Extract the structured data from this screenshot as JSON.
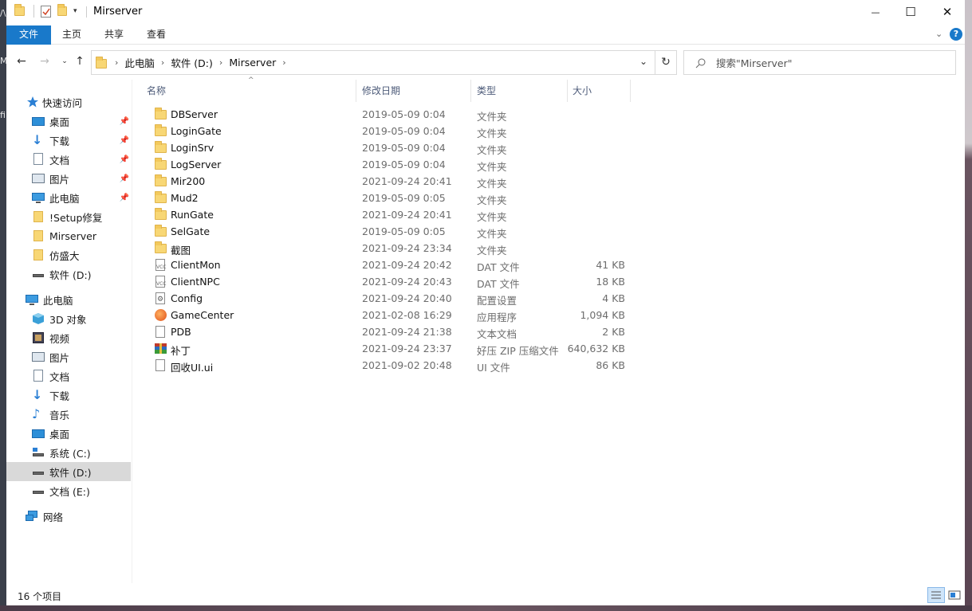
{
  "window": {
    "title": "Mirserver",
    "controls": {
      "minimize": "—",
      "maximize": "☐",
      "close": "✕"
    }
  },
  "ribbon": {
    "tabs": [
      "文件",
      "主页",
      "共享",
      "查看"
    ],
    "active_tab": "文件"
  },
  "address": {
    "crumbs": [
      "此电脑",
      "软件 (D:)",
      "Mirserver"
    ]
  },
  "search": {
    "placeholder": "搜索\"Mirserver\""
  },
  "sidebar": {
    "quick_access": {
      "label": "快速访问",
      "items": [
        {
          "label": "桌面",
          "icon": "desktop-icon",
          "pinned": true
        },
        {
          "label": "下载",
          "icon": "download-icon",
          "pinned": true
        },
        {
          "label": "文档",
          "icon": "document-icon",
          "pinned": true
        },
        {
          "label": "图片",
          "icon": "picture-icon",
          "pinned": true
        },
        {
          "label": "此电脑",
          "icon": "computer-icon",
          "pinned": true
        },
        {
          "label": "!Setup修复",
          "icon": "folder-icon",
          "pinned": false
        },
        {
          "label": "Mirserver",
          "icon": "folder-icon",
          "pinned": false
        },
        {
          "label": "仿盛大",
          "icon": "folder-icon",
          "pinned": false
        },
        {
          "label": "软件 (D:)",
          "icon": "drive-icon",
          "pinned": false
        }
      ]
    },
    "this_pc": {
      "label": "此电脑",
      "items": [
        {
          "label": "3D 对象",
          "icon": "3d-objects-icon"
        },
        {
          "label": "视频",
          "icon": "video-icon"
        },
        {
          "label": "图片",
          "icon": "picture-icon"
        },
        {
          "label": "文档",
          "icon": "document-icon"
        },
        {
          "label": "下载",
          "icon": "download-icon"
        },
        {
          "label": "音乐",
          "icon": "music-icon"
        },
        {
          "label": "桌面",
          "icon": "desktop-icon"
        },
        {
          "label": "系统 (C:)",
          "icon": "system-drive-icon"
        },
        {
          "label": "软件 (D:)",
          "icon": "drive-icon",
          "selected": true
        },
        {
          "label": "文档 (E:)",
          "icon": "drive-icon"
        }
      ]
    },
    "network": {
      "label": "网络"
    }
  },
  "columns": {
    "name": "名称",
    "date": "修改日期",
    "type": "类型",
    "size": "大小"
  },
  "files": [
    {
      "name": "DBServer",
      "date": "2019-05-09 0:04",
      "type": "文件夹",
      "size": "",
      "icon": "folder-icon"
    },
    {
      "name": "LoginGate",
      "date": "2019-05-09 0:04",
      "type": "文件夹",
      "size": "",
      "icon": "folder-icon"
    },
    {
      "name": "LoginSrv",
      "date": "2019-05-09 0:04",
      "type": "文件夹",
      "size": "",
      "icon": "folder-icon"
    },
    {
      "name": "LogServer",
      "date": "2019-05-09 0:04",
      "type": "文件夹",
      "size": "",
      "icon": "folder-icon"
    },
    {
      "name": "Mir200",
      "date": "2021-09-24 20:41",
      "type": "文件夹",
      "size": "",
      "icon": "folder-icon"
    },
    {
      "name": "Mud2",
      "date": "2019-05-09 0:05",
      "type": "文件夹",
      "size": "",
      "icon": "folder-icon"
    },
    {
      "name": "RunGate",
      "date": "2021-09-24 20:41",
      "type": "文件夹",
      "size": "",
      "icon": "folder-icon"
    },
    {
      "name": "SelGate",
      "date": "2019-05-09 0:05",
      "type": "文件夹",
      "size": "",
      "icon": "folder-icon"
    },
    {
      "name": "截图",
      "date": "2021-09-24 23:34",
      "type": "文件夹",
      "size": "",
      "icon": "folder-icon"
    },
    {
      "name": "ClientMon",
      "date": "2021-09-24 20:42",
      "type": "DAT 文件",
      "size": "41 KB",
      "icon": "dat-file-icon"
    },
    {
      "name": "ClientNPC",
      "date": "2021-09-24 20:43",
      "type": "DAT 文件",
      "size": "18 KB",
      "icon": "dat-file-icon"
    },
    {
      "name": "Config",
      "date": "2021-09-24 20:40",
      "type": "配置设置",
      "size": "4 KB",
      "icon": "config-file-icon"
    },
    {
      "name": "GameCenter",
      "date": "2021-02-08 16:29",
      "type": "应用程序",
      "size": "1,094 KB",
      "icon": "app-icon"
    },
    {
      "name": "PDB",
      "date": "2021-09-24 21:38",
      "type": "文本文档",
      "size": "2 KB",
      "icon": "text-file-icon"
    },
    {
      "name": "补丁",
      "date": "2021-09-24 23:37",
      "type": "好压 ZIP 压缩文件",
      "size": "640,632 KB",
      "icon": "zip-archive-icon"
    },
    {
      "name": "回收UI.ui",
      "date": "2021-09-02 20:48",
      "type": "UI 文件",
      "size": "86 KB",
      "icon": "generic-file-icon"
    }
  ],
  "status": {
    "count": "16 个项目"
  },
  "colors": {
    "accent": "#1979ca",
    "selected": "#d9d9d9",
    "folder": "#f8d775"
  }
}
